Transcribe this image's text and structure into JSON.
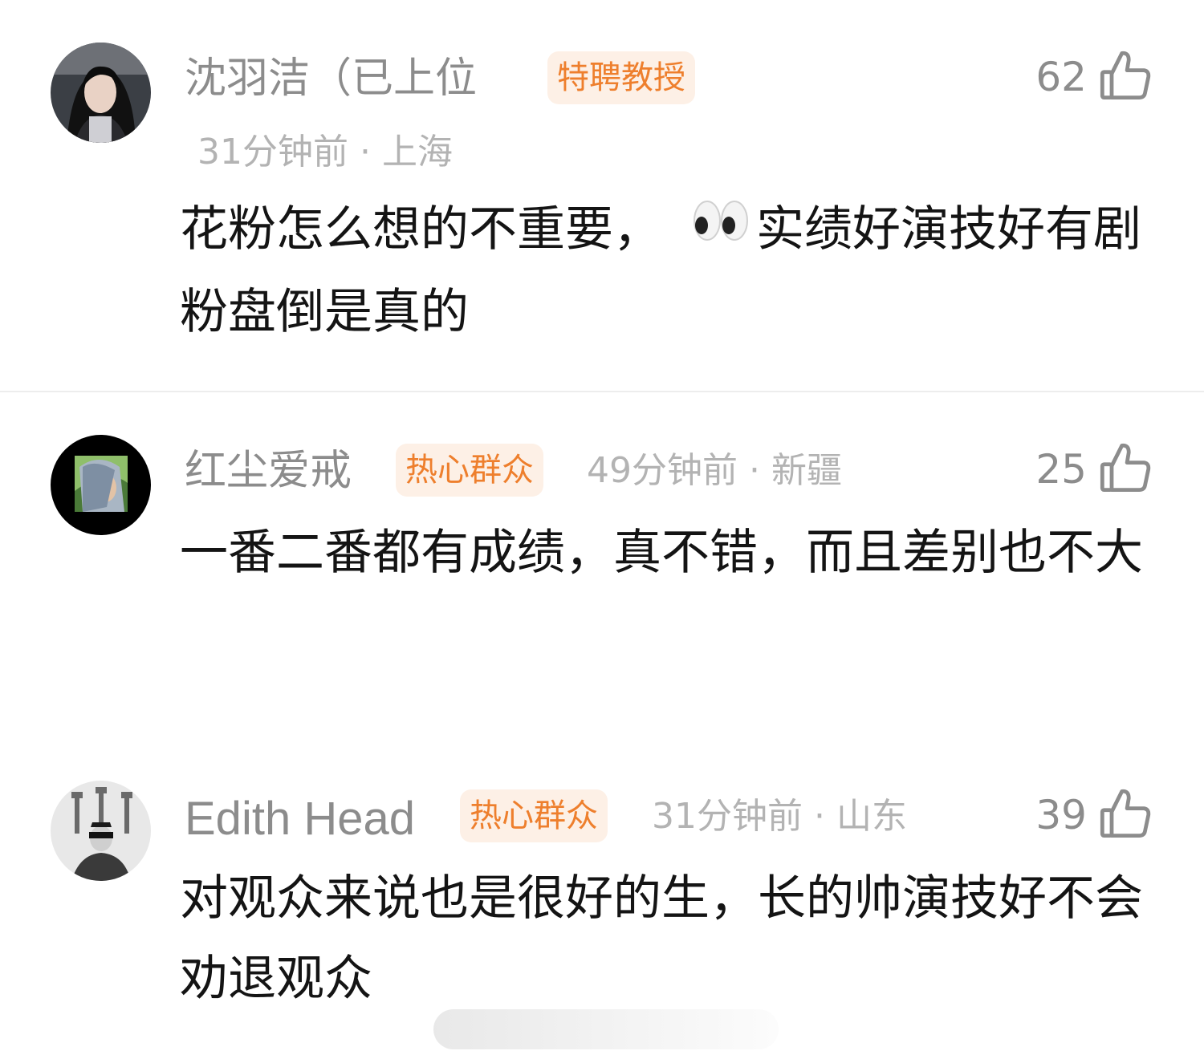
{
  "comments": [
    {
      "username": "沈羽洁（已上位",
      "badge": "特聘教授",
      "time": "31分钟前",
      "location": "上海",
      "likes": "62",
      "text_a": "花粉怎么想的不重要，",
      "emoji": "eyes-emoji",
      "text_b": "实绩好演技好有剧粉盘倒是真的"
    },
    {
      "username": "红尘爱戒",
      "badge": "热心群众",
      "time": "49分钟前",
      "location": "新疆",
      "likes": "25",
      "text": "一番二番都有成绩，真不错，而且差别也不大"
    },
    {
      "username": "Edith Head",
      "badge": "热心群众",
      "time": "31分钟前",
      "location": "山东",
      "likes": "39",
      "text": "对观众来说也是很好的生，长的帅演技好不会劝退观众"
    }
  ],
  "separator": "·",
  "icons": {
    "like": "thumbs-up-icon"
  },
  "colors": {
    "badge_text": "#ee7f2d",
    "badge_bg": "#fdf0e6",
    "username": "#8c8c8c",
    "meta": "#b3b3b3",
    "body": "#141414"
  }
}
